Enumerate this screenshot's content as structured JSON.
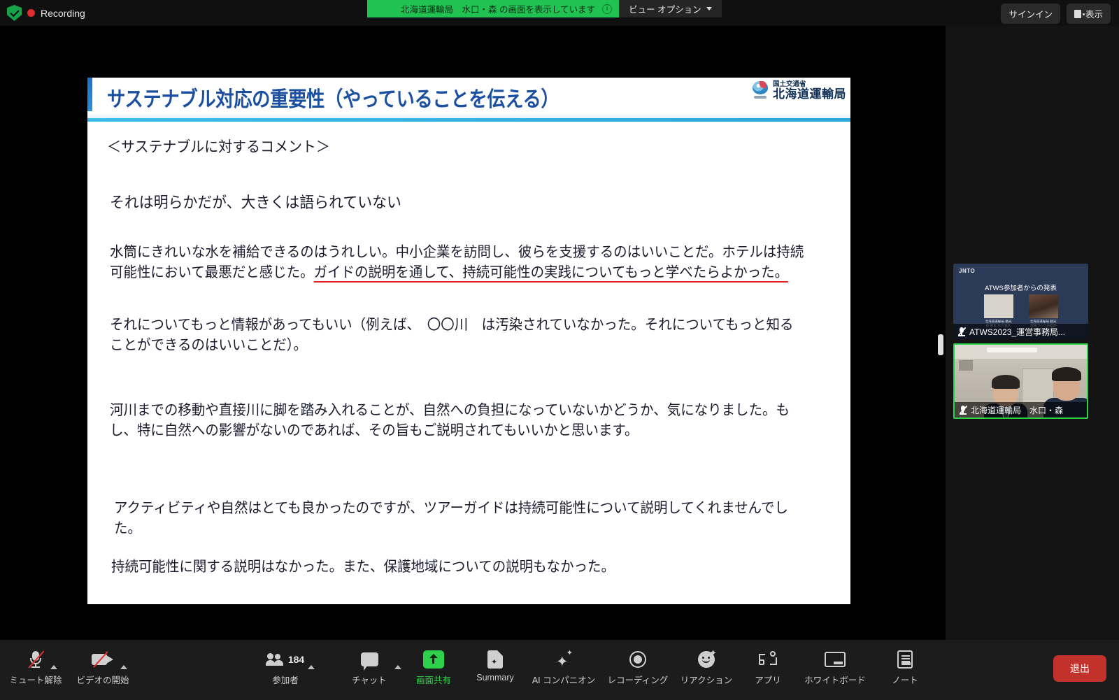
{
  "topbar": {
    "recording_label": "Recording",
    "security_icon": "shield-check-icon",
    "share_banner": "北海道運輸局　水口・森 の画面を表示しています",
    "share_info_icon": "info-icon",
    "view_options_label": "ビュー オプション",
    "sign_in_label": "サインイン",
    "display_label": "表示"
  },
  "slide": {
    "title": "サステナブル対応の重要性（やっていることを伝える）",
    "logo_small": "国土交通省",
    "logo_large": "北海道運輸局",
    "heading": "＜サステナブルに対するコメント＞",
    "p1": "それは明らかだが、大きくは語られていない",
    "p2_plain": "水筒にきれいな水を補給できるのはうれしい。中小企業を訪問し、彼らを支援するのはいいことだ。ホテルは持続可能性において最悪だと感じた。",
    "p2_underlined": "ガイドの説明を通して、持続可能性の実践についてもっと学べたらよかった。",
    "p3": "それについてもっと情報があってもいい（例えば、　〇〇川　は汚染されていなかった。それについてもっと知ることができるのはいいことだ）。",
    "p4": "河川までの移動や直接川に脚を踏み入れることが、自然への負担になっていないかどうか、気になりました。もし、特に自然への影響がないのであれば、その旨もご説明されてもいいかと思います。",
    "p5": "アクティビティや自然はとても良かったのですが、ツアーガイドは持続可能性について説明してくれませんでした。",
    "p6": "持続可能性に関する説明はなかった。また、保護地域についての説明もなかった。",
    "accent_color": "#2aa6d8",
    "title_color": "#1b4fa0",
    "underline_color": "#e02020"
  },
  "participants_panel": {
    "thumbnails": [
      {
        "name": "ATWS2023_運営事務局...",
        "mic_icon": "mic-muted-icon",
        "slide_logo": "JNTO",
        "slide_title": "ATWS参加者からの発表",
        "person_1_caption": "北海道運輸局 観光部\n部長 水口 猛久",
        "person_2_caption": "北海道運輸局 観光地域づくり企画課\n専門官 森 美貴 氏",
        "active_speaker": false
      },
      {
        "name": "北海道運輸局　水口・森",
        "mic_icon": "mic-muted-icon",
        "active_speaker": true,
        "active_border_color": "#2ed24a"
      }
    ]
  },
  "toolbar": {
    "items": [
      {
        "label": "ミュート解除",
        "icon": "mic-muted-icon",
        "has_caret": true,
        "active": false
      },
      {
        "label": "ビデオの開始",
        "icon": "video-off-icon",
        "has_caret": true,
        "active": false
      },
      {
        "label": "参加者",
        "icon": "participants-icon",
        "count": "184",
        "has_caret": true,
        "active": false
      },
      {
        "label": "チャット",
        "icon": "chat-icon",
        "has_caret": true,
        "active": false
      },
      {
        "label": "画面共有",
        "icon": "share-screen-icon",
        "has_caret": false,
        "active": true
      },
      {
        "label": "Summary",
        "icon": "summary-doc-icon",
        "has_caret": false,
        "active": false
      },
      {
        "label": "AI コンパニオン",
        "icon": "ai-sparkle-icon",
        "has_caret": false,
        "active": false
      },
      {
        "label": "レコーディング",
        "icon": "record-icon",
        "has_caret": false,
        "active": false
      },
      {
        "label": "リアクション",
        "icon": "reaction-smiley-icon",
        "has_caret": false,
        "active": false
      },
      {
        "label": "アプリ",
        "icon": "apps-icon",
        "has_caret": false,
        "active": false
      },
      {
        "label": "ホワイトボード",
        "icon": "whiteboard-icon",
        "has_caret": false,
        "active": false
      },
      {
        "label": "ノート",
        "icon": "notes-icon",
        "has_caret": false,
        "active": false
      }
    ],
    "leave_label": "退出",
    "leave_color": "#c3312c",
    "active_color": "#2ed24a"
  }
}
